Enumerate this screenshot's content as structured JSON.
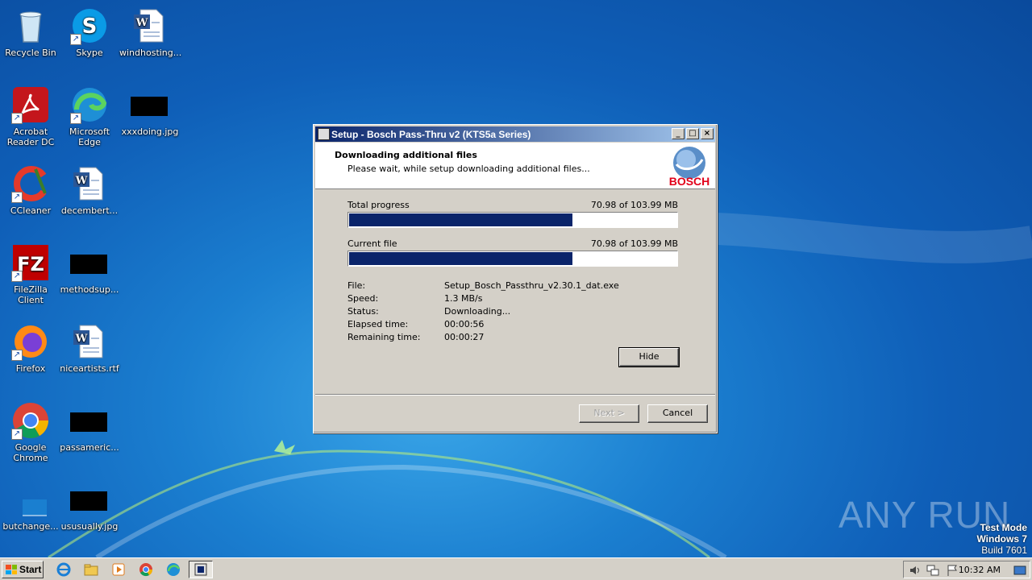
{
  "desktop": {
    "icons": [
      {
        "label": "Recycle Bin"
      },
      {
        "label": "Skype"
      },
      {
        "label": "windhosting..."
      },
      {
        "label": "Acrobat Reader DC"
      },
      {
        "label": "Microsoft Edge"
      },
      {
        "label": "xxxdoing.jpg"
      },
      {
        "label": "CCleaner"
      },
      {
        "label": "decembert..."
      },
      {
        "label": "FileZilla Client"
      },
      {
        "label": "methodsup..."
      },
      {
        "label": "Firefox"
      },
      {
        "label": "niceartists.rtf"
      },
      {
        "label": "Google Chrome"
      },
      {
        "label": "passameric..."
      },
      {
        "label": "butchange..."
      },
      {
        "label": "ususually.jpg"
      }
    ]
  },
  "dialog": {
    "title": "Setup - Bosch Pass-Thru v2 (KTS5a Series)",
    "header_title": "Downloading additional files",
    "header_subtitle": "Please wait, while setup downloading additional files...",
    "logo_text": "BOSCH",
    "total_progress_label": "Total progress",
    "total_progress_value": "70.98 of 103.99 MB",
    "total_progress_fraction": 0.6826,
    "current_file_label": "Current file",
    "current_file_value": "70.98 of 103.99 MB",
    "current_file_fraction": 0.6826,
    "details": [
      {
        "label": "File:",
        "value": "Setup_Bosch_Passthru_v2.30.1_dat.exe"
      },
      {
        "label": "Speed:",
        "value": "1.3 MB/s"
      },
      {
        "label": "Status:",
        "value": "Downloading..."
      },
      {
        "label": "Elapsed time:",
        "value": "00:00:56"
      },
      {
        "label": "Remaining time:",
        "value": "00:00:27"
      }
    ],
    "hide_label": "Hide",
    "next_label": "Next >",
    "cancel_label": "Cancel",
    "title_buttons": {
      "minimize": "_",
      "maximize": "□",
      "close": "×"
    }
  },
  "watermark": {
    "brand": "ANY RUN",
    "line1": "Test Mode",
    "line2": "Windows 7",
    "line3": "Build 7601"
  },
  "taskbar": {
    "start_label": "Start",
    "clock": "10:32 AM"
  },
  "colors": {
    "accent": "#0a246a",
    "window_face": "#d4d0c8",
    "bosch_red": "#e2001a"
  }
}
